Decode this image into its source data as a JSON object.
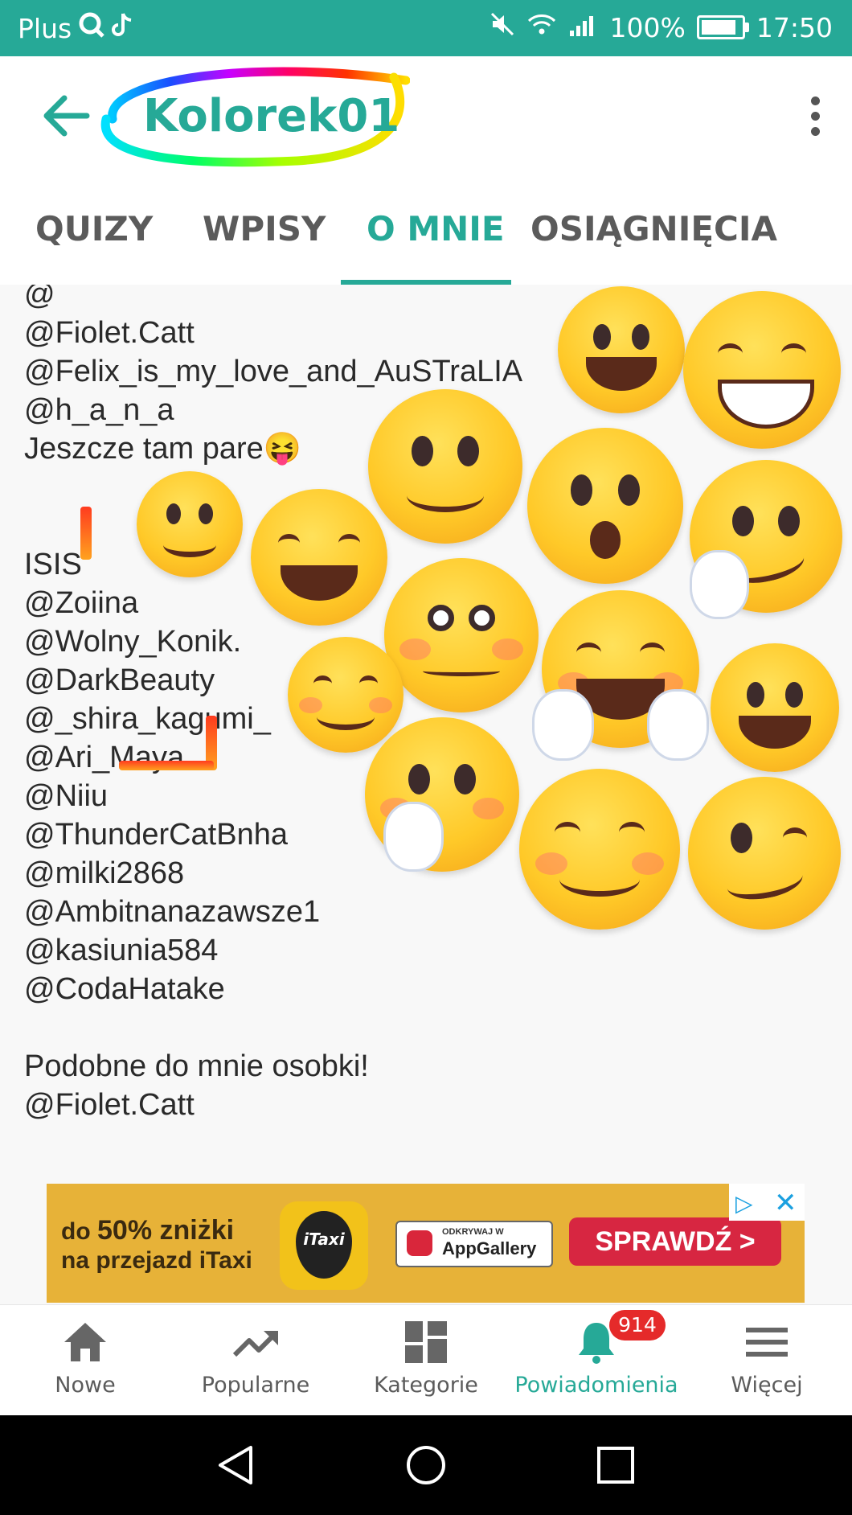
{
  "status_bar": {
    "carrier": "Plus",
    "battery": "100%",
    "battery_level": 1.0,
    "time": "17:50"
  },
  "app_bar": {
    "title": "Kolorek01"
  },
  "tabs": [
    {
      "label": "QUIZY",
      "active": false
    },
    {
      "label": "WPISY",
      "active": false
    },
    {
      "label": "O MNIE",
      "active": true
    },
    {
      "label": "OSIĄGNIĘCIA",
      "active": false
    }
  ],
  "content": {
    "lines": [
      "@",
      "@Fiolet.Catt",
      "@Felix_is_my_love_and_AuSTraLIA",
      "@h_a_n_a",
      "Jeszcze tam pare😝",
      "",
      "",
      "ISIS",
      "@Zoiina",
      "@Wolny_Konik.",
      "@DarkBeauty",
      "@_shira_kagumi_",
      "@Ari_Maya",
      "@Niiu",
      "@ThunderCatBnha",
      "@milki2868",
      "@Ambitnanazawsze1",
      "@kasiunia584",
      "@CodaHatake",
      "",
      "Podobne do mnie osobki!",
      "@Fiolet.Catt"
    ]
  },
  "ad": {
    "line1_prefix": "do ",
    "line1_big": "50% zniżki",
    "line2": "na przejazd iTaxi",
    "logo_text": "iTaxi",
    "store_small": "ODKRYWAJ W",
    "store_name": "AppGallery",
    "cta": "SPRAWDŹ >"
  },
  "bottom_nav": [
    {
      "label": "Nowe",
      "icon": "home-icon",
      "active": false
    },
    {
      "label": "Popularne",
      "icon": "trending-icon",
      "active": false
    },
    {
      "label": "Kategorie",
      "icon": "grid-icon",
      "active": false
    },
    {
      "label": "Powiadomienia",
      "icon": "bell-icon",
      "active": true,
      "badge": "914"
    },
    {
      "label": "Więcej",
      "icon": "menu-icon",
      "active": false
    }
  ],
  "colors": {
    "accent": "#26a997",
    "badge": "#e52a2a",
    "ad_background": "#e7b238",
    "ad_cta": "#d72641"
  }
}
